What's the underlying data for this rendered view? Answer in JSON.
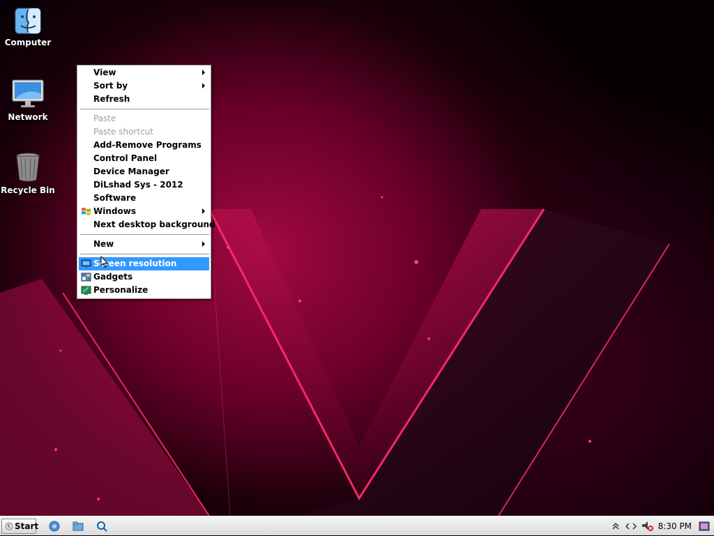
{
  "desktop": {
    "icons": [
      {
        "label": "Computer",
        "icon": "finder-icon"
      },
      {
        "label": "Network",
        "icon": "monitor-icon"
      },
      {
        "label": "Recycle Bin",
        "icon": "trash-icon"
      }
    ]
  },
  "context_menu": {
    "items": [
      {
        "label": "View",
        "submenu": true
      },
      {
        "label": "Sort by",
        "submenu": true
      },
      {
        "label": "Refresh"
      },
      {
        "label": "Paste",
        "disabled": true
      },
      {
        "label": "Paste shortcut",
        "disabled": true
      },
      {
        "label": "Add-Remove Programs"
      },
      {
        "label": "Control Panel"
      },
      {
        "label": "Device Manager"
      },
      {
        "label": "DiLshad Sys - 2012"
      },
      {
        "label": "Software"
      },
      {
        "label": "Windows",
        "submenu": true,
        "icon": "windows-flag-icon"
      },
      {
        "label": "Next desktop background"
      },
      {
        "label": "New",
        "submenu": true
      },
      {
        "label": "Screen resolution",
        "highlighted": true,
        "icon": "display-settings-icon"
      },
      {
        "label": "Gadgets",
        "icon": "gadgets-icon"
      },
      {
        "label": "Personalize",
        "icon": "personalize-icon"
      }
    ]
  },
  "taskbar": {
    "start_label": "Start",
    "quick_launch": [
      "browser-icon",
      "folder-icon",
      "search-icon"
    ],
    "tray_icons": [
      "show-hidden-icons-icon",
      "network-icon",
      "volume-muted-icon",
      "action-center-icon"
    ],
    "clock": "8:30 PM"
  },
  "colors": {
    "highlight": "#3399ff",
    "wallpaper_accent": "#e0105a"
  }
}
